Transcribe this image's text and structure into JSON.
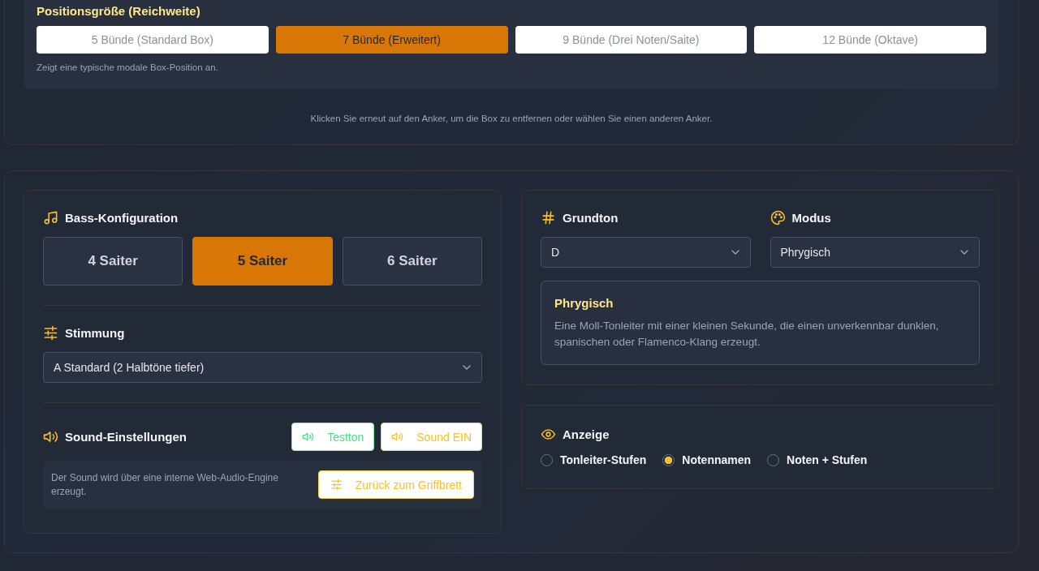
{
  "position_size": {
    "title": "Positionsgröße (Reichweite)",
    "options": [
      {
        "label": "5 Bünde (Standard Box)",
        "selected": false
      },
      {
        "label": "7 Bünde (Erweitert)",
        "selected": true
      },
      {
        "label": "9 Bünde (Drei Noten/Saite)",
        "selected": false
      },
      {
        "label": "12 Bünde (Oktave)",
        "selected": false
      }
    ],
    "description": "Zeigt eine typische modale Box-Position an."
  },
  "hint": "Klicken Sie erneut auf den Anker, um die Box zu entfernen oder wählen Sie einen anderen Anker.",
  "bass": {
    "title": "Bass-Konfiguration",
    "strings": [
      {
        "label": "4 Saiter",
        "selected": false
      },
      {
        "label": "5 Saiter",
        "selected": true
      },
      {
        "label": "6 Saiter",
        "selected": false
      }
    ]
  },
  "tuning": {
    "title": "Stimmung",
    "value": "A Standard (2 Halbtöne tiefer)"
  },
  "sound": {
    "title": "Sound-Einstellungen",
    "buttons": [
      {
        "label": "Testton",
        "kind": "test"
      },
      {
        "label": "Sound EIN",
        "kind": "toggle"
      }
    ],
    "note": "Der Sound wird über eine interne Web-Audio-Engine erzeugt.",
    "back_button": "Zurück zum Griffbrett"
  },
  "root": {
    "title": "Grundton",
    "value": "D"
  },
  "mode": {
    "title": "Modus",
    "value": "Phrygisch"
  },
  "mode_info": {
    "title": "Phrygisch",
    "description": "Eine Moll-Tonleiter mit einer kleinen Sekunde, die einen unverkennbar dunklen, spanischen oder Flamenco-Klang erzeugt."
  },
  "display": {
    "title": "Anzeige",
    "options": [
      {
        "label": "Tonleiter-Stufen",
        "selected": false
      },
      {
        "label": "Notennamen",
        "selected": true
      },
      {
        "label": "Noten + Stufen",
        "selected": false
      }
    ]
  }
}
